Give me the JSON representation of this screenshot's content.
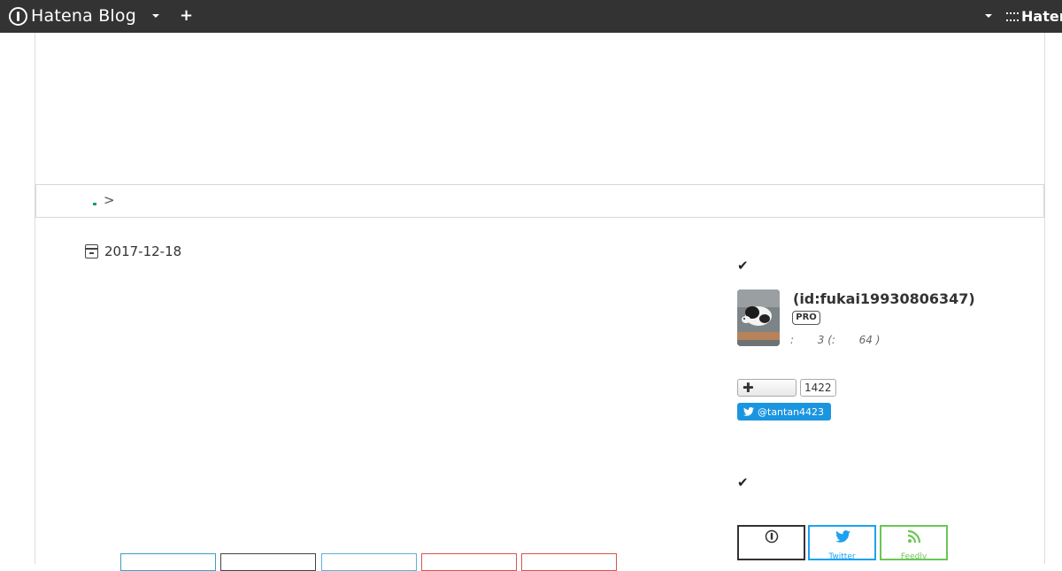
{
  "header": {
    "brand": "Hatena Blog",
    "right_brand": "Haten",
    "icons": [
      "hatena-logo-icon",
      "chevron-down-icon",
      "plus-icon"
    ]
  },
  "breadcrumb": {
    "separator": ">"
  },
  "entry": {
    "date": "2017-12-18"
  },
  "sidebar": {
    "profile": {
      "user_id": "(id:fukai19930806347)",
      "badge": "PRO",
      "stats": ":       3 (:       64 )"
    },
    "follow": {
      "count": "1422"
    },
    "twitter": {
      "handle": "@tantan4423"
    },
    "subscribe": [
      {
        "label": "",
        "color": "#333333",
        "icon": "hatena-icon"
      },
      {
        "label": "Twitter",
        "color": "#1da1f2",
        "icon": "twitter-icon"
      },
      {
        "label": "Feedly",
        "color": "#6cc655",
        "icon": "rss-icon"
      }
    ]
  },
  "share_buttons": [
    {
      "color": "#3aa0c8"
    },
    {
      "color": "#444444"
    },
    {
      "color": "#5ab4d6"
    },
    {
      "color": "#d9534f"
    },
    {
      "color": "#d9534f"
    }
  ]
}
